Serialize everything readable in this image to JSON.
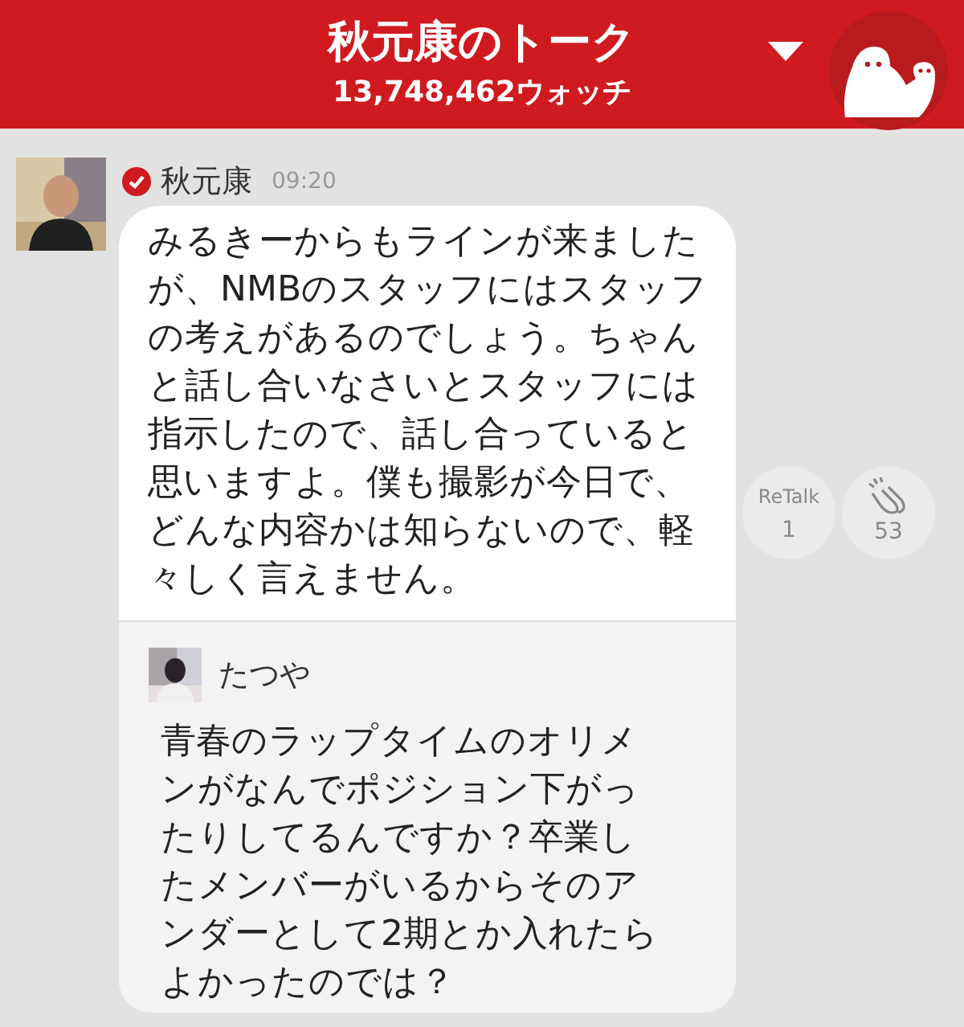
{
  "header": {
    "title": "秋元康のトーク",
    "watch_count": "13,748,462ウォッチ"
  },
  "post": {
    "author": "秋元康",
    "verified": true,
    "time": "09:20",
    "message": "みるきーからもラインが来ましたが、NMBのスタッフにはスタッフの考えがあるのでしょう。ちゃんと話し合いなさいとスタッフには指示したので、話し合っていると思いますよ。僕も撮影が今日で、どんな内容かは知らないので、軽々しく言えません。",
    "retalk": {
      "label": "ReTalk",
      "count": "1"
    },
    "claps": {
      "count": "53"
    },
    "quote": {
      "author": "たつや",
      "message": "青春のラップタイムのオリメンがなんでポジション下がったりしてるんですか？卒業したメンバーがいるからそのアンダーとして2期とか入れたらよかったのでは？"
    }
  }
}
